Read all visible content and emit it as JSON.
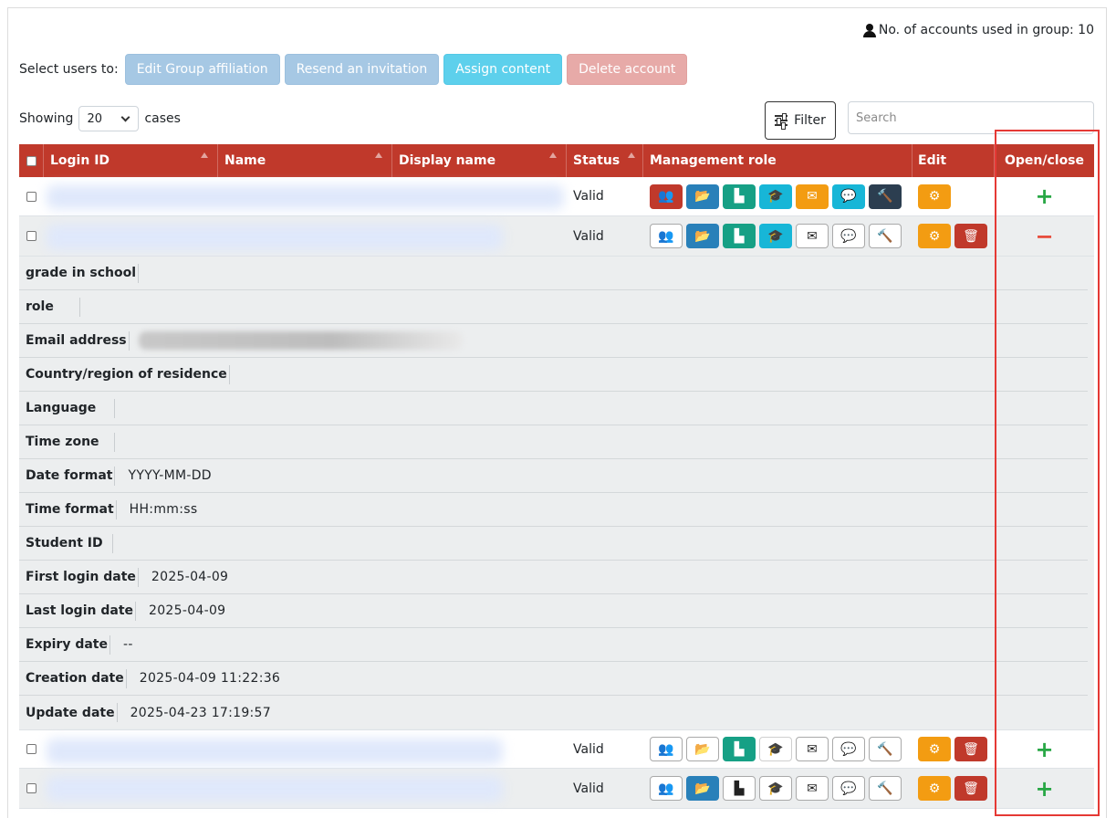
{
  "header": {
    "accounts_used_text": "No. of accounts used in group: 10",
    "select_users_label": "Select users to:",
    "actions": [
      "Edit Group affiliation",
      "Resend an invitation",
      "Assign content",
      "Delete account"
    ]
  },
  "paging": {
    "showing_label": "Showing",
    "page_size": "20",
    "cases_label": "cases",
    "filter_label": "Filter",
    "search_placeholder": "Search"
  },
  "table": {
    "columns": [
      "Login ID",
      "Name",
      "Display name",
      "Status",
      "Management role",
      "Edit",
      "Open/close"
    ],
    "rows": [
      {
        "status": "Valid",
        "toggle": "+"
      },
      {
        "status": "Valid",
        "toggle": "−"
      },
      {
        "status": "Valid",
        "toggle": "+"
      },
      {
        "status": "Valid",
        "toggle": "+"
      }
    ]
  },
  "details": [
    {
      "label": "grade in school",
      "value": ""
    },
    {
      "label": "role",
      "value": ""
    },
    {
      "label": "Email address",
      "value": ""
    },
    {
      "label": "Country/region of residence",
      "value": ""
    },
    {
      "label": "Language",
      "value": ""
    },
    {
      "label": "Time zone",
      "value": ""
    },
    {
      "label": "Date format",
      "value": "YYYY-MM-DD"
    },
    {
      "label": "Time format",
      "value": "HH:mm:ss"
    },
    {
      "label": "Student ID",
      "value": ""
    },
    {
      "label": "First login date",
      "value": "2025-04-09"
    },
    {
      "label": "Last login date",
      "value": "2025-04-09"
    },
    {
      "label": "Expiry date",
      "value": "--"
    },
    {
      "label": "Creation date",
      "value": "2025-04-09 11:22:36"
    },
    {
      "label": "Update date",
      "value": "2025-04-23 17:19:57"
    }
  ],
  "icons": {
    "users": "users-icon",
    "folder": "folder-open-icon",
    "chart": "chart-icon",
    "graduation": "graduation-cap-icon",
    "mail": "envelope-icon",
    "chat": "comments-icon",
    "hammer": "hammer-icon",
    "gear": "gear-icon",
    "trash": "trash-icon"
  },
  "colors": {
    "header_bg": "#c0392b",
    "highlight_frame": "#e53935",
    "plus": "#28a745",
    "minus": "#e74c3c"
  }
}
